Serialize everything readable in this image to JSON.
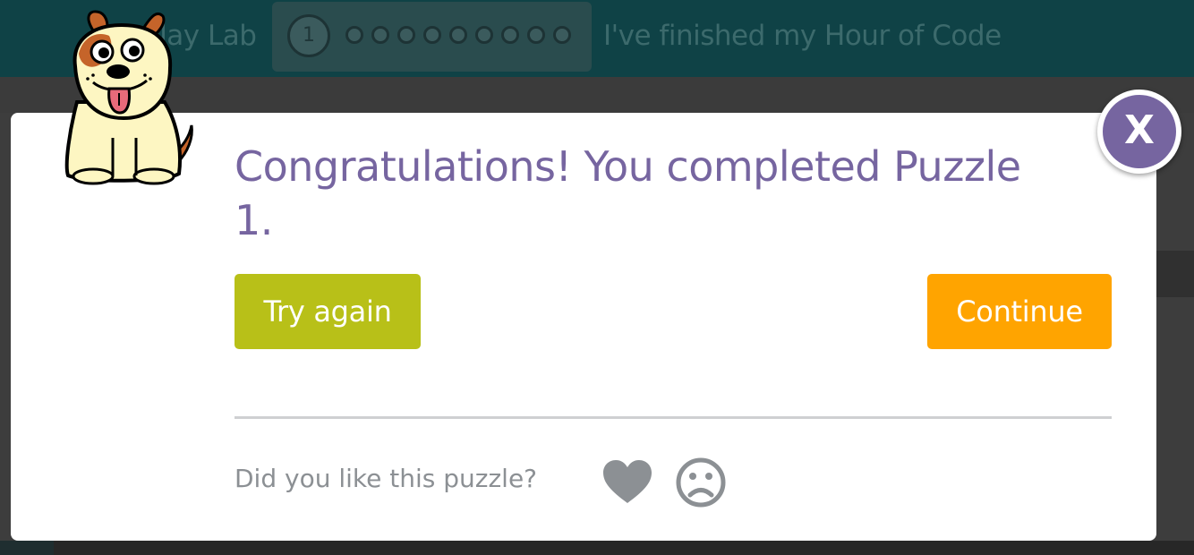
{
  "header": {
    "title": "Play Lab",
    "progress_current": "1",
    "finish_link": "I've finished my Hour of Code"
  },
  "dialog": {
    "heading": "Congratulations! You completed Puzzle 1.",
    "try_again_label": "Try again",
    "continue_label": "Continue",
    "feedback_prompt": "Did you like this puzzle?",
    "close_label": "X"
  },
  "icons": {
    "like": "heart-icon",
    "dislike": "frown-icon",
    "mascot": "dog-mascot-icon"
  },
  "colors": {
    "accent_purple": "#7665a0",
    "try_again_green": "#b8c018",
    "continue_orange": "#ffa400",
    "feedback_gray": "#8c9094"
  }
}
